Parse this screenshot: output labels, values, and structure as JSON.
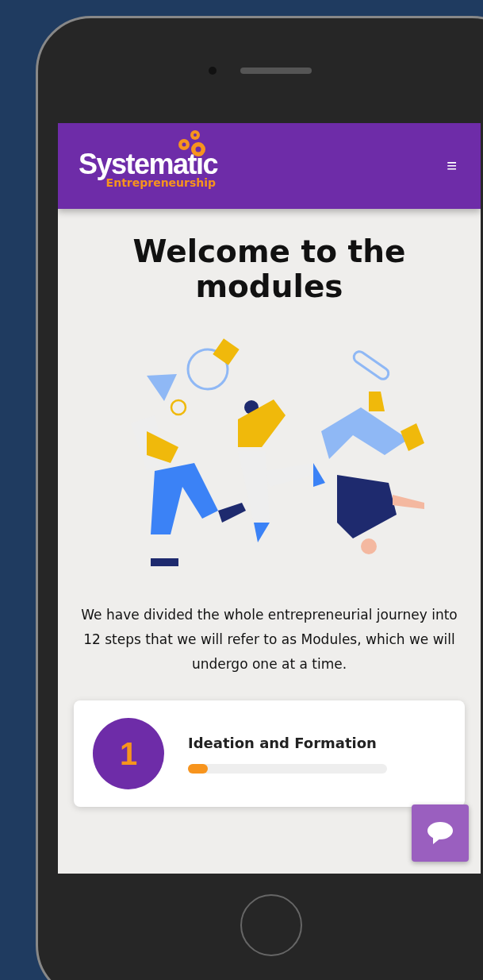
{
  "header": {
    "logo_title": "Systematic",
    "logo_subtitle": "Entrepreneurship",
    "menu_icon": "≡"
  },
  "heading": "Welcome to the modules",
  "intro": "We have divided the whole entrepreneurial journey into 12 steps that we will refer to as Modules, which we will undergo one at a time.",
  "modules": [
    {
      "number": "1",
      "title": "Ideation and Formation",
      "level": 0.1
    }
  ]
}
